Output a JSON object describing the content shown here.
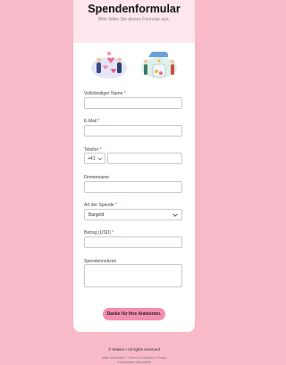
{
  "header": {
    "title": "Spendenformular",
    "subtitle": "Bitte füllen Sie dieses Formular aus."
  },
  "form": {
    "full_name_label": "Vollständiger Name",
    "email_label": "E-Mail",
    "phone_label": "Telefon",
    "phone_country_code": "+41",
    "company_label": "Firmenname",
    "donation_type_label": "Art der Spende",
    "donation_type_value": "Bargeld",
    "amount_label": "Betrag (USD)",
    "notes_label": "Spendennotizen",
    "required_marker": "*",
    "submit_label": "Danke für Ihre Antworten."
  },
  "footer": {
    "brand": "© Makes • All rights reserved",
    "fine_print_line1": "Made with Makes™ • Terms & Conditions • Privacy",
    "fine_print_line2": "in accordance with policies"
  },
  "colors": {
    "background": "#f8b9c8",
    "accent": "#f58fb0",
    "header": "#fde6ec"
  }
}
